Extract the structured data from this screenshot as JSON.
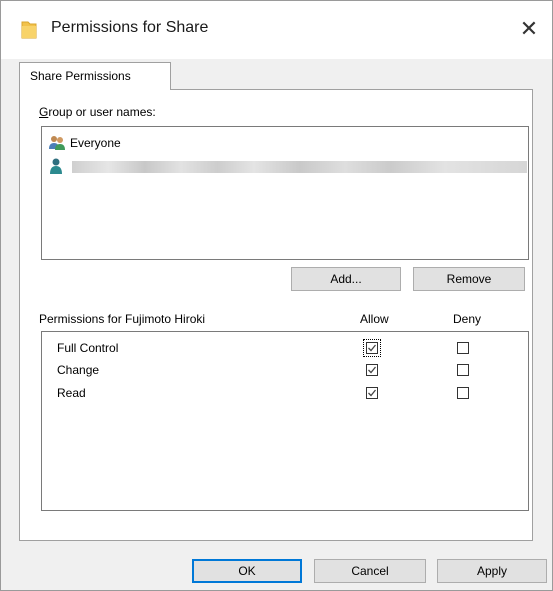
{
  "window": {
    "title": "Permissions for Share",
    "icon": "folder-icon",
    "close_glyph": "✕"
  },
  "tab": {
    "label": "Share Permissions"
  },
  "group_section": {
    "label": "Group or user names:",
    "items": [
      {
        "name": "Everyone",
        "icon": "group-users-icon"
      },
      {
        "name": "",
        "icon": "user-icon",
        "redacted": true
      }
    ],
    "add_label": "Add...",
    "remove_label": "Remove"
  },
  "permissions": {
    "header_label": "Permissions for Fujimoto Hiroki",
    "allow_header": "Allow",
    "deny_header": "Deny",
    "rows": [
      {
        "name": "Full Control",
        "allow": true,
        "deny": false
      },
      {
        "name": "Change",
        "allow": true,
        "deny": false
      },
      {
        "name": "Read",
        "allow": true,
        "deny": false
      }
    ]
  },
  "footer": {
    "ok_label": "OK",
    "cancel_label": "Cancel",
    "apply_label": "Apply"
  },
  "colors": {
    "accent": "#0078d7",
    "button_bg": "#e1e1e1",
    "dialog_bg": "#f0f0f0"
  }
}
